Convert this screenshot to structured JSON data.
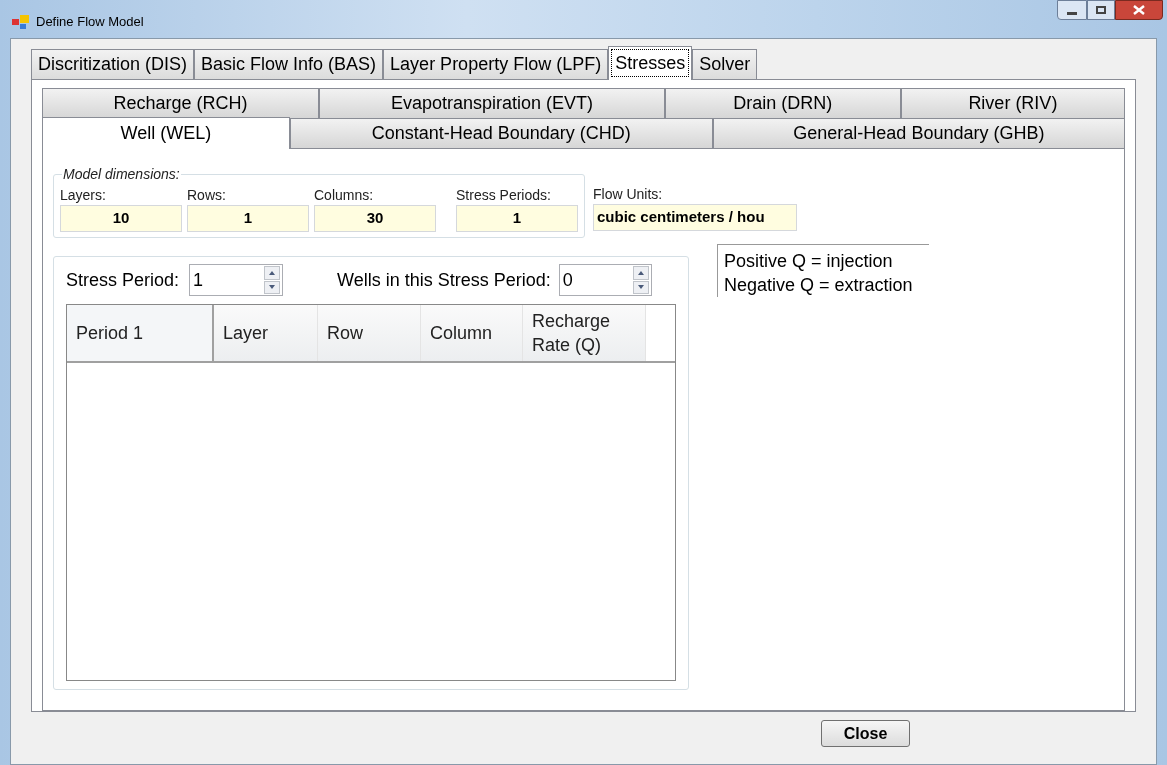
{
  "window": {
    "title": "Define Flow Model"
  },
  "main_tabs": [
    {
      "label": "Discritization (DIS)",
      "selected": false
    },
    {
      "label": "Basic Flow Info (BAS)",
      "selected": false
    },
    {
      "label": "Layer Property  Flow (LPF)",
      "selected": false
    },
    {
      "label": "Stresses",
      "selected": true
    },
    {
      "label": "Solver",
      "selected": false
    }
  ],
  "sub_tab_rows": [
    {
      "tabs": [
        {
          "label": "Recharge (RCH)",
          "selected": false
        },
        {
          "label": "Evapotranspiration (EVT)",
          "selected": false
        },
        {
          "label": "Drain (DRN)",
          "selected": false
        },
        {
          "label": "River (RIV)",
          "selected": false
        }
      ]
    },
    {
      "tabs": [
        {
          "label": "Well (WEL)",
          "selected": true
        },
        {
          "label": "Constant-Head Boundary (CHD)",
          "selected": false
        },
        {
          "label": "General-Head Boundary (GHB)",
          "selected": false
        }
      ]
    }
  ],
  "model_dimensions": {
    "title": "Model dimensions:",
    "fields": [
      {
        "label": "Layers:",
        "value": "10"
      },
      {
        "label": "Rows:",
        "value": "1"
      },
      {
        "label": "Columns:",
        "value": "30"
      },
      {
        "label": "Stress Periods:",
        "value": "1"
      }
    ],
    "flow_units": {
      "label": "Flow Units:",
      "value": "cubic centimeters / hou"
    }
  },
  "stress": {
    "stress_period": {
      "label": "Stress Period:",
      "value": "1"
    },
    "wells": {
      "label": "Wells in this Stress Period:",
      "value": "0"
    },
    "table": {
      "columns": [
        "Period 1",
        "Layer",
        "Row",
        "Column",
        "Recharge Rate (Q)"
      ]
    }
  },
  "legend": [
    "Positive Q = injection",
    "Negative Q = extraction"
  ],
  "close_button": "Close"
}
